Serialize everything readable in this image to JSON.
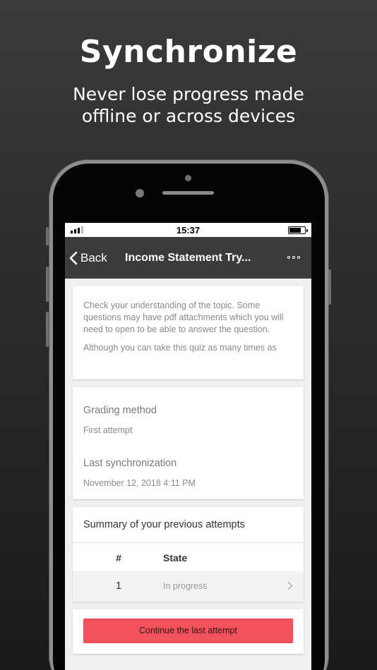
{
  "marketing": {
    "headline": "Synchronize",
    "subline_1": "Never lose progress made",
    "subline_2": "offline or across devices"
  },
  "status_bar": {
    "time": "15:37"
  },
  "nav": {
    "back_label": "Back",
    "title": "Income Statement Try...",
    "more_icon": "ellipsis-icon"
  },
  "description": {
    "text": "Check your understanding of the topic. Some questions may have pdf attachments which you will need to open to be able to answer the question.",
    "text_continued": "Although you can take this quiz as many times as"
  },
  "info": {
    "grading_label": "Grading method",
    "grading_value": "First attempt",
    "sync_label": "Last synchronization",
    "sync_value": "November 12, 2018 4:11 PM"
  },
  "attempts": {
    "title": "Summary of your previous attempts",
    "columns": [
      "#",
      "State"
    ],
    "rows": [
      {
        "number": "1",
        "state": "In progress"
      }
    ]
  },
  "actions": {
    "continue_label": "Continue the last attempt"
  },
  "colors": {
    "navbar": "#3b3b3b",
    "accent_button": "#f2525b",
    "background": "#2b2b2b"
  }
}
